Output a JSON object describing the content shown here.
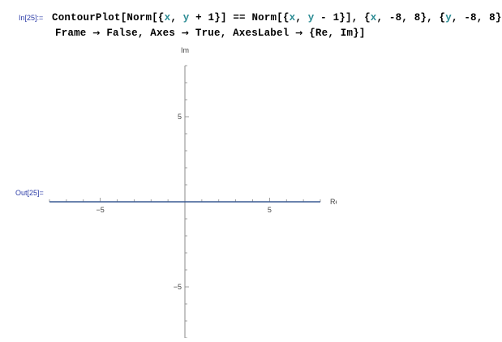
{
  "cells": {
    "input_label": "In[25]:=",
    "output_label": "Out[25]=",
    "code": {
      "line1": [
        {
          "t": "ContourPlot[Norm[{",
          "c": "kw"
        },
        {
          "t": "x",
          "c": "var"
        },
        {
          "t": ", ",
          "c": "kw"
        },
        {
          "t": "y",
          "c": "var"
        },
        {
          "t": " + 1}] == Norm[{",
          "c": "kw"
        },
        {
          "t": "x",
          "c": "var"
        },
        {
          "t": ", ",
          "c": "kw"
        },
        {
          "t": "y",
          "c": "var"
        },
        {
          "t": " - 1}], {",
          "c": "kw"
        },
        {
          "t": "x",
          "c": "var"
        },
        {
          "t": ", -8, 8}, {",
          "c": "kw"
        },
        {
          "t": "y",
          "c": "var"
        },
        {
          "t": ", -8, 8},",
          "c": "kw"
        }
      ],
      "line2": [
        {
          "t": "Frame ",
          "c": "kw"
        },
        {
          "t": "→",
          "c": "arrow"
        },
        {
          "t": " False, Axes ",
          "c": "kw"
        },
        {
          "t": "→",
          "c": "arrow"
        },
        {
          "t": " True, AxesLabel ",
          "c": "kw"
        },
        {
          "t": "→",
          "c": "arrow"
        },
        {
          "t": " {Re, Im}]",
          "c": "kw"
        }
      ]
    }
  },
  "chart_data": {
    "type": "line",
    "title": "",
    "xlabel": "Re",
    "ylabel": "Im",
    "xlim": [
      -8,
      8
    ],
    "ylim": [
      -8,
      8
    ],
    "xticks": [
      -5,
      5
    ],
    "yticks": [
      5,
      -5
    ],
    "series": [
      {
        "x": [
          -8,
          8
        ],
        "y": [
          0,
          0
        ],
        "color": "#3a5a94"
      }
    ],
    "grid": false,
    "axis_color": "#888888"
  }
}
